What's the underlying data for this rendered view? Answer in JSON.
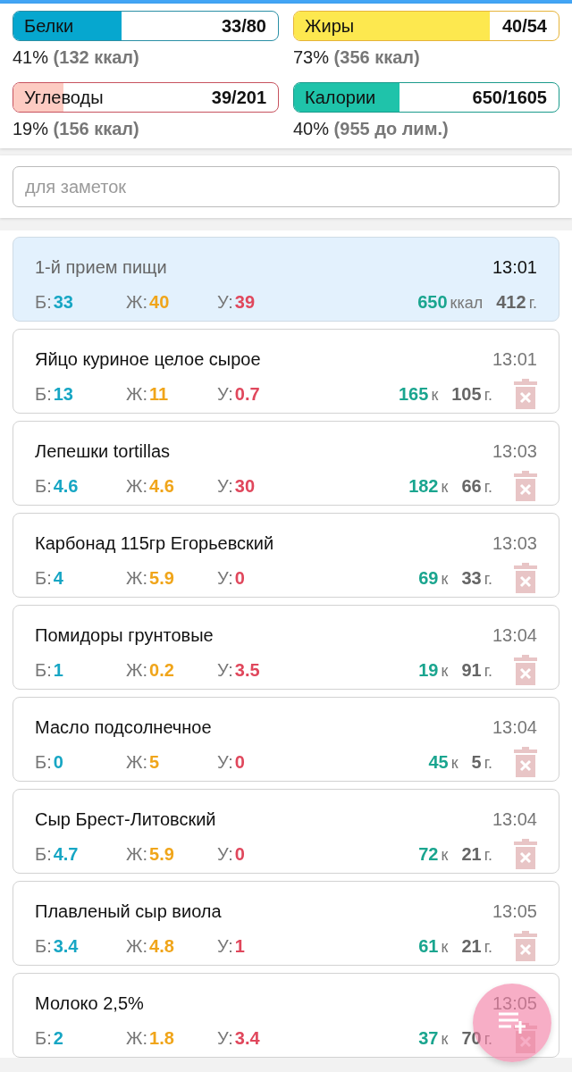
{
  "summary": [
    {
      "kind": "protein",
      "label": "Белки",
      "value": "33/80",
      "level": 0.41,
      "percent": "41%",
      "detail": "(132 ккал)"
    },
    {
      "kind": "fat",
      "label": "Жиры",
      "value": "40/54",
      "level": 0.74,
      "percent": "73%",
      "detail": "(356 ккал)"
    },
    {
      "kind": "carbs",
      "label": "Углеводы",
      "value": "39/201",
      "level": 0.19,
      "percent": "19%",
      "detail": "(156 ккал)"
    },
    {
      "kind": "calories",
      "label": "Калории",
      "value": "650/1605",
      "level": 0.4,
      "percent": "40%",
      "detail": "(955 до лим.)"
    }
  ],
  "notes": {
    "placeholder": "для заметок"
  },
  "meal": {
    "title": "1-й прием пищи",
    "time": "13:01",
    "macros": [
      {
        "kind": "protein",
        "label": "Б:",
        "value": "33"
      },
      {
        "kind": "fat",
        "label": "Ж:",
        "value": "40"
      },
      {
        "kind": "carbs",
        "label": "У:",
        "value": "39"
      }
    ],
    "kcal": "650",
    "kcal_unit": "ккал",
    "grams": "412",
    "grams_unit": "г."
  },
  "items": [
    {
      "name": "Яйцо куриное целое сырое",
      "time": "13:01",
      "macros": [
        {
          "kind": "protein",
          "label": "Б:",
          "value": "13"
        },
        {
          "kind": "fat",
          "label": "Ж:",
          "value": "11"
        },
        {
          "kind": "carbs",
          "label": "У:",
          "value": "0.7"
        }
      ],
      "kcal": "165",
      "kcal_unit": "к",
      "grams": "105",
      "grams_unit": "г."
    },
    {
      "name": "Лепешки tortillas",
      "time": "13:03",
      "macros": [
        {
          "kind": "protein",
          "label": "Б:",
          "value": "4.6"
        },
        {
          "kind": "fat",
          "label": "Ж:",
          "value": "4.6"
        },
        {
          "kind": "carbs",
          "label": "У:",
          "value": "30"
        }
      ],
      "kcal": "182",
      "kcal_unit": "к",
      "grams": "66",
      "grams_unit": "г."
    },
    {
      "name": "Карбонад 115гр Егорьевский",
      "time": "13:03",
      "macros": [
        {
          "kind": "protein",
          "label": "Б:",
          "value": "4"
        },
        {
          "kind": "fat",
          "label": "Ж:",
          "value": "5.9"
        },
        {
          "kind": "carbs",
          "label": "У:",
          "value": "0"
        }
      ],
      "kcal": "69",
      "kcal_unit": "к",
      "grams": "33",
      "grams_unit": "г."
    },
    {
      "name": "Помидоры грунтовые",
      "time": "13:04",
      "macros": [
        {
          "kind": "protein",
          "label": "Б:",
          "value": "1"
        },
        {
          "kind": "fat",
          "label": "Ж:",
          "value": "0.2"
        },
        {
          "kind": "carbs",
          "label": "У:",
          "value": "3.5"
        }
      ],
      "kcal": "19",
      "kcal_unit": "к",
      "grams": "91",
      "grams_unit": "г."
    },
    {
      "name": "Масло подсолнечное",
      "time": "13:04",
      "macros": [
        {
          "kind": "protein",
          "label": "Б:",
          "value": "0"
        },
        {
          "kind": "fat",
          "label": "Ж:",
          "value": "5"
        },
        {
          "kind": "carbs",
          "label": "У:",
          "value": "0"
        }
      ],
      "kcal": "45",
      "kcal_unit": "к",
      "grams": "5",
      "grams_unit": "г."
    },
    {
      "name": "Сыр Брест-Литовский",
      "time": "13:04",
      "macros": [
        {
          "kind": "protein",
          "label": "Б:",
          "value": "4.7"
        },
        {
          "kind": "fat",
          "label": "Ж:",
          "value": "5.9"
        },
        {
          "kind": "carbs",
          "label": "У:",
          "value": "0"
        }
      ],
      "kcal": "72",
      "kcal_unit": "к",
      "grams": "21",
      "grams_unit": "г."
    },
    {
      "name": "Плавленый сыр виола",
      "time": "13:05",
      "macros": [
        {
          "kind": "protein",
          "label": "Б:",
          "value": "3.4"
        },
        {
          "kind": "fat",
          "label": "Ж:",
          "value": "4.8"
        },
        {
          "kind": "carbs",
          "label": "У:",
          "value": "1"
        }
      ],
      "kcal": "61",
      "kcal_unit": "к",
      "grams": "21",
      "grams_unit": "г."
    },
    {
      "name": "Молоко 2,5%",
      "time": "13:05",
      "macros": [
        {
          "kind": "protein",
          "label": "Б:",
          "value": "2"
        },
        {
          "kind": "fat",
          "label": "Ж:",
          "value": "1.8"
        },
        {
          "kind": "carbs",
          "label": "У:",
          "value": "3.4"
        }
      ],
      "kcal": "37",
      "kcal_unit": "к",
      "grams": "70",
      "grams_unit": "г."
    }
  ]
}
